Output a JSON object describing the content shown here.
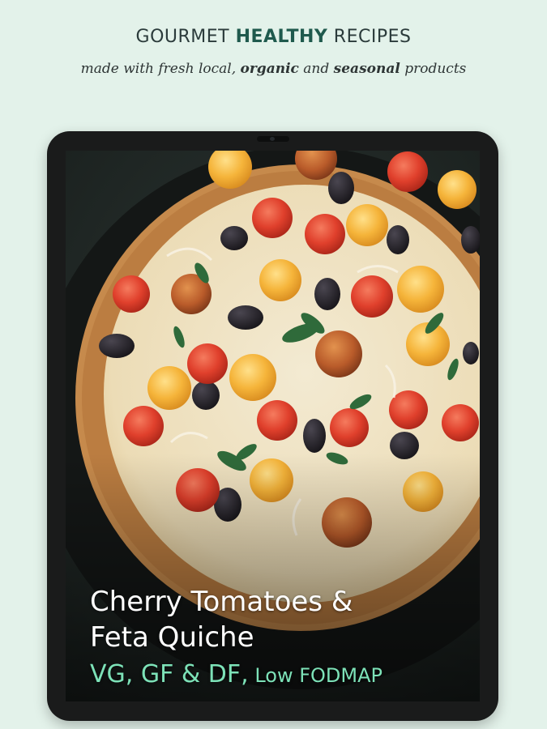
{
  "header": {
    "headline_part1": "GOURMET ",
    "headline_bold": "HEALTHY",
    "headline_part2": " RECIPES",
    "sub_part1": "made with fresh local, ",
    "sub_bold1": "organic",
    "sub_part2": " and ",
    "sub_bold2": "seasonal",
    "sub_part3": " products"
  },
  "recipe": {
    "title_line1": "Cherry Tomatoes &",
    "title_line2": "Feta Quiche",
    "diet_tags": "VG, GF & DF,",
    "diet_extra": " Low FODMAP"
  },
  "colors": {
    "background": "#e3f2ea",
    "accent_green": "#1f5a4d",
    "tag_green": "#7de2b8",
    "tablet_frame": "#1a1b1b"
  }
}
